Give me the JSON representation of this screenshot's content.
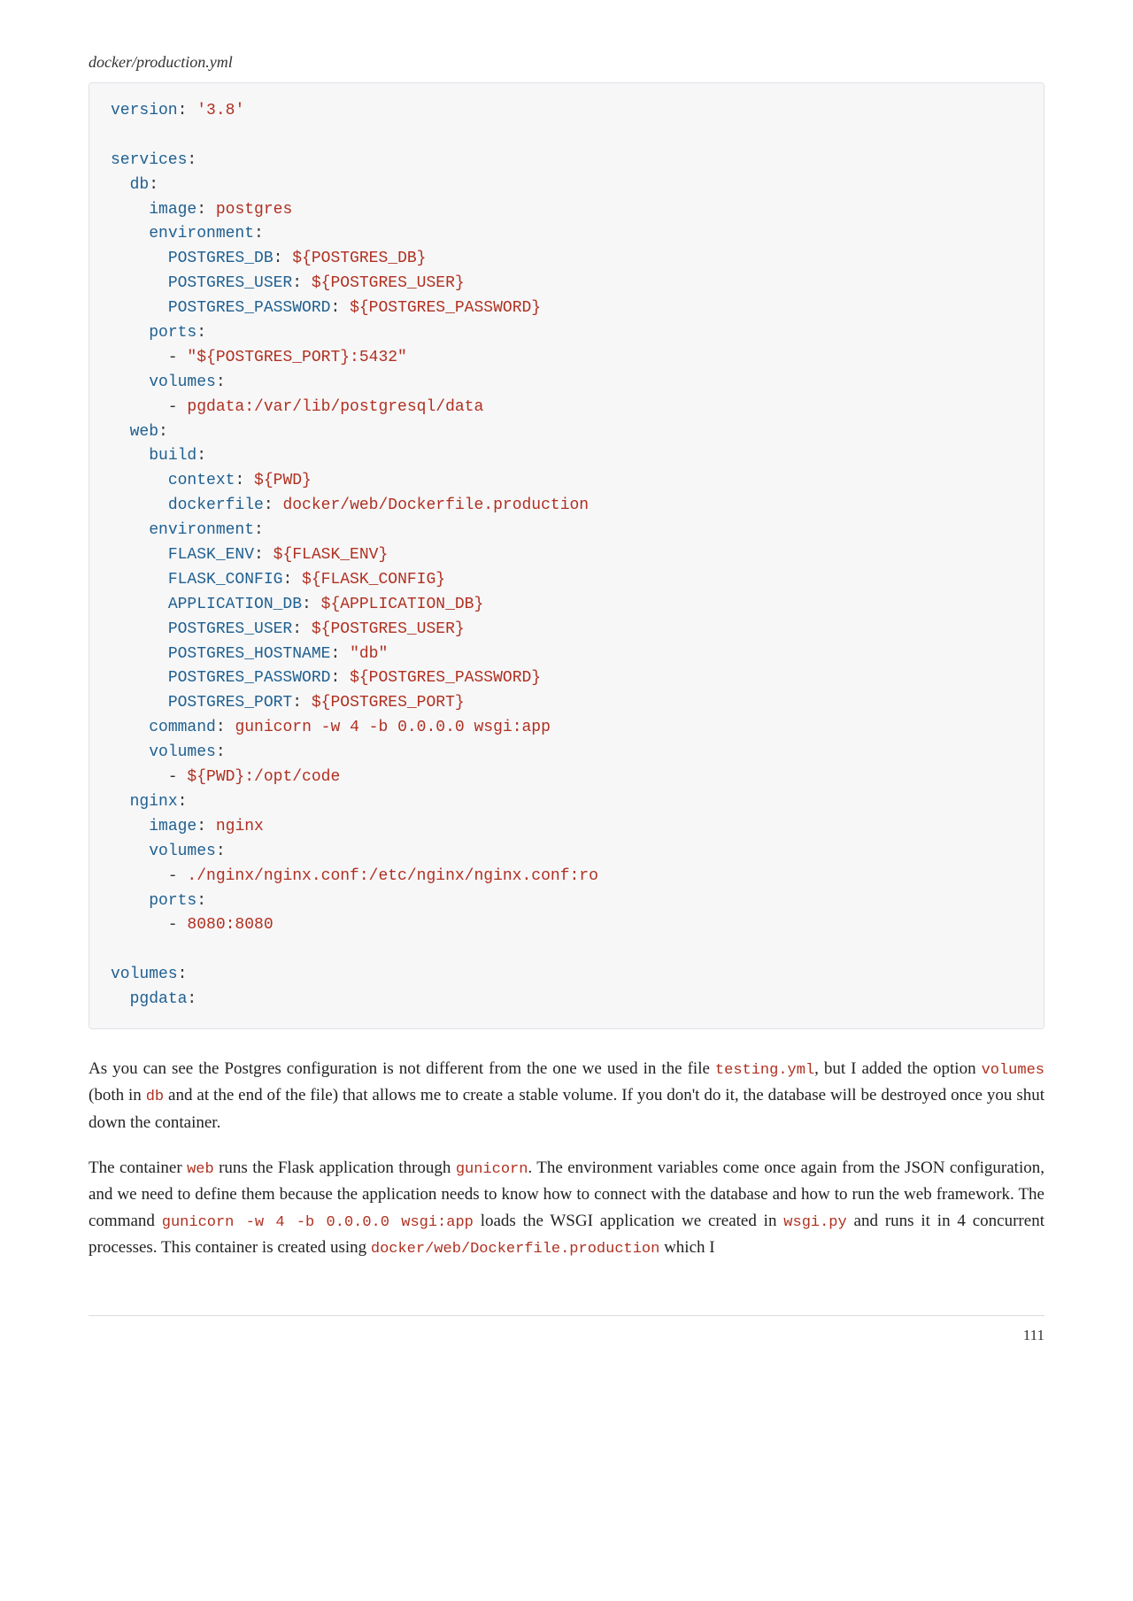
{
  "file_label": "docker/production.yml",
  "code": {
    "lines": [
      [
        [
          "k",
          "version"
        ],
        [
          "p",
          ": "
        ],
        [
          "s",
          "'3.8'"
        ]
      ],
      [],
      [
        [
          "k",
          "services"
        ],
        [
          "p",
          ":"
        ]
      ],
      [
        [
          "p",
          "  "
        ],
        [
          "k",
          "db"
        ],
        [
          "p",
          ":"
        ]
      ],
      [
        [
          "p",
          "    "
        ],
        [
          "k",
          "image"
        ],
        [
          "p",
          ": "
        ],
        [
          "s",
          "postgres"
        ]
      ],
      [
        [
          "p",
          "    "
        ],
        [
          "k",
          "environment"
        ],
        [
          "p",
          ":"
        ]
      ],
      [
        [
          "p",
          "      "
        ],
        [
          "k",
          "POSTGRES_DB"
        ],
        [
          "p",
          ": "
        ],
        [
          "s",
          "${POSTGRES_DB}"
        ]
      ],
      [
        [
          "p",
          "      "
        ],
        [
          "k",
          "POSTGRES_USER"
        ],
        [
          "p",
          ": "
        ],
        [
          "s",
          "${POSTGRES_USER}"
        ]
      ],
      [
        [
          "p",
          "      "
        ],
        [
          "k",
          "POSTGRES_PASSWORD"
        ],
        [
          "p",
          ": "
        ],
        [
          "s",
          "${POSTGRES_PASSWORD}"
        ]
      ],
      [
        [
          "p",
          "    "
        ],
        [
          "k",
          "ports"
        ],
        [
          "p",
          ":"
        ]
      ],
      [
        [
          "p",
          "      - "
        ],
        [
          "s",
          "\"${POSTGRES_PORT}:5432\""
        ]
      ],
      [
        [
          "p",
          "    "
        ],
        [
          "k",
          "volumes"
        ],
        [
          "p",
          ":"
        ]
      ],
      [
        [
          "p",
          "      - "
        ],
        [
          "s",
          "pgdata:/var/lib/postgresql/data"
        ]
      ],
      [
        [
          "p",
          "  "
        ],
        [
          "k",
          "web"
        ],
        [
          "p",
          ":"
        ]
      ],
      [
        [
          "p",
          "    "
        ],
        [
          "k",
          "build"
        ],
        [
          "p",
          ":"
        ]
      ],
      [
        [
          "p",
          "      "
        ],
        [
          "k",
          "context"
        ],
        [
          "p",
          ": "
        ],
        [
          "s",
          "${PWD}"
        ]
      ],
      [
        [
          "p",
          "      "
        ],
        [
          "k",
          "dockerfile"
        ],
        [
          "p",
          ": "
        ],
        [
          "s",
          "docker/web/Dockerfile.production"
        ]
      ],
      [
        [
          "p",
          "    "
        ],
        [
          "k",
          "environment"
        ],
        [
          "p",
          ":"
        ]
      ],
      [
        [
          "p",
          "      "
        ],
        [
          "k",
          "FLASK_ENV"
        ],
        [
          "p",
          ": "
        ],
        [
          "s",
          "${FLASK_ENV}"
        ]
      ],
      [
        [
          "p",
          "      "
        ],
        [
          "k",
          "FLASK_CONFIG"
        ],
        [
          "p",
          ": "
        ],
        [
          "s",
          "${FLASK_CONFIG}"
        ]
      ],
      [
        [
          "p",
          "      "
        ],
        [
          "k",
          "APPLICATION_DB"
        ],
        [
          "p",
          ": "
        ],
        [
          "s",
          "${APPLICATION_DB}"
        ]
      ],
      [
        [
          "p",
          "      "
        ],
        [
          "k",
          "POSTGRES_USER"
        ],
        [
          "p",
          ": "
        ],
        [
          "s",
          "${POSTGRES_USER}"
        ]
      ],
      [
        [
          "p",
          "      "
        ],
        [
          "k",
          "POSTGRES_HOSTNAME"
        ],
        [
          "p",
          ": "
        ],
        [
          "s",
          "\"db\""
        ]
      ],
      [
        [
          "p",
          "      "
        ],
        [
          "k",
          "POSTGRES_PASSWORD"
        ],
        [
          "p",
          ": "
        ],
        [
          "s",
          "${POSTGRES_PASSWORD}"
        ]
      ],
      [
        [
          "p",
          "      "
        ],
        [
          "k",
          "POSTGRES_PORT"
        ],
        [
          "p",
          ": "
        ],
        [
          "s",
          "${POSTGRES_PORT}"
        ]
      ],
      [
        [
          "p",
          "    "
        ],
        [
          "k",
          "command"
        ],
        [
          "p",
          ": "
        ],
        [
          "s",
          "gunicorn -w 4 -b 0.0.0.0 wsgi:app"
        ]
      ],
      [
        [
          "p",
          "    "
        ],
        [
          "k",
          "volumes"
        ],
        [
          "p",
          ":"
        ]
      ],
      [
        [
          "p",
          "      - "
        ],
        [
          "s",
          "${PWD}:/opt/code"
        ]
      ],
      [
        [
          "p",
          "  "
        ],
        [
          "k",
          "nginx"
        ],
        [
          "p",
          ":"
        ]
      ],
      [
        [
          "p",
          "    "
        ],
        [
          "k",
          "image"
        ],
        [
          "p",
          ": "
        ],
        [
          "s",
          "nginx"
        ]
      ],
      [
        [
          "p",
          "    "
        ],
        [
          "k",
          "volumes"
        ],
        [
          "p",
          ":"
        ]
      ],
      [
        [
          "p",
          "      - "
        ],
        [
          "s",
          "./nginx/nginx.conf:/etc/nginx/nginx.conf:ro"
        ]
      ],
      [
        [
          "p",
          "    "
        ],
        [
          "k",
          "ports"
        ],
        [
          "p",
          ":"
        ]
      ],
      [
        [
          "p",
          "      - "
        ],
        [
          "s",
          "8080:8080"
        ]
      ],
      [],
      [
        [
          "k",
          "volumes"
        ],
        [
          "p",
          ":"
        ]
      ],
      [
        [
          "p",
          "  "
        ],
        [
          "k",
          "pgdata"
        ],
        [
          "p",
          ":"
        ]
      ]
    ]
  },
  "para1": {
    "t0": "As you can see the Postgres configuration is not different from the one we used in the file ",
    "c1": "testing.yml",
    "t1": ", but I added the option ",
    "c2": "volumes",
    "t2": " (both in ",
    "c3": "db",
    "t3": " and at the end of the file) that allows me to create a stable volume. If you don't do it, the database will be destroyed once you shut down the container."
  },
  "para2": {
    "t0": "The container ",
    "c1": "web",
    "t1": " runs the Flask application through ",
    "c2": "gunicorn",
    "t2": ". The environment variables come once again from the JSON configuration, and we need to define them because the application needs to know how to connect with the database and how to run the web framework. The command ",
    "c3": "gunicorn -w 4 -b 0.0.0.0 wsgi:app",
    "t3": " loads the WSGI application we created in ",
    "c4": "wsgi.py",
    "t4": " and runs it in 4 concurrent processes. This container is created using ",
    "c5": "docker/web/Dockerfile.production",
    "t5": " which I"
  },
  "page_number": "111"
}
